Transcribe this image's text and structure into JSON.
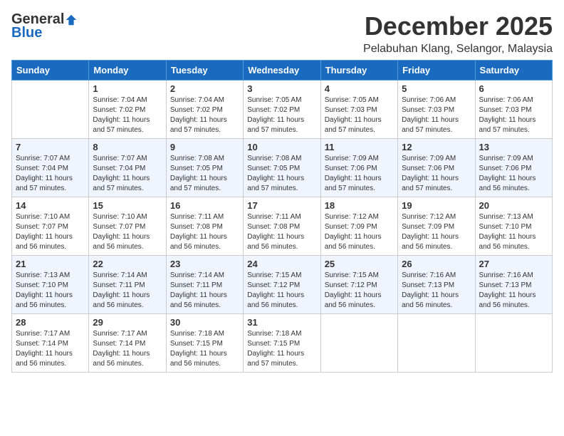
{
  "logo": {
    "general": "General",
    "blue": "Blue"
  },
  "title": "December 2025",
  "subtitle": "Pelabuhan Klang, Selangor, Malaysia",
  "weekdays": [
    "Sunday",
    "Monday",
    "Tuesday",
    "Wednesday",
    "Thursday",
    "Friday",
    "Saturday"
  ],
  "weeks": [
    [
      {
        "day": "",
        "info": ""
      },
      {
        "day": "1",
        "info": "Sunrise: 7:04 AM\nSunset: 7:02 PM\nDaylight: 11 hours\nand 57 minutes."
      },
      {
        "day": "2",
        "info": "Sunrise: 7:04 AM\nSunset: 7:02 PM\nDaylight: 11 hours\nand 57 minutes."
      },
      {
        "day": "3",
        "info": "Sunrise: 7:05 AM\nSunset: 7:02 PM\nDaylight: 11 hours\nand 57 minutes."
      },
      {
        "day": "4",
        "info": "Sunrise: 7:05 AM\nSunset: 7:03 PM\nDaylight: 11 hours\nand 57 minutes."
      },
      {
        "day": "5",
        "info": "Sunrise: 7:06 AM\nSunset: 7:03 PM\nDaylight: 11 hours\nand 57 minutes."
      },
      {
        "day": "6",
        "info": "Sunrise: 7:06 AM\nSunset: 7:03 PM\nDaylight: 11 hours\nand 57 minutes."
      }
    ],
    [
      {
        "day": "7",
        "info": "Sunrise: 7:07 AM\nSunset: 7:04 PM\nDaylight: 11 hours\nand 57 minutes."
      },
      {
        "day": "8",
        "info": "Sunrise: 7:07 AM\nSunset: 7:04 PM\nDaylight: 11 hours\nand 57 minutes."
      },
      {
        "day": "9",
        "info": "Sunrise: 7:08 AM\nSunset: 7:05 PM\nDaylight: 11 hours\nand 57 minutes."
      },
      {
        "day": "10",
        "info": "Sunrise: 7:08 AM\nSunset: 7:05 PM\nDaylight: 11 hours\nand 57 minutes."
      },
      {
        "day": "11",
        "info": "Sunrise: 7:09 AM\nSunset: 7:06 PM\nDaylight: 11 hours\nand 57 minutes."
      },
      {
        "day": "12",
        "info": "Sunrise: 7:09 AM\nSunset: 7:06 PM\nDaylight: 11 hours\nand 57 minutes."
      },
      {
        "day": "13",
        "info": "Sunrise: 7:09 AM\nSunset: 7:06 PM\nDaylight: 11 hours\nand 56 minutes."
      }
    ],
    [
      {
        "day": "14",
        "info": "Sunrise: 7:10 AM\nSunset: 7:07 PM\nDaylight: 11 hours\nand 56 minutes."
      },
      {
        "day": "15",
        "info": "Sunrise: 7:10 AM\nSunset: 7:07 PM\nDaylight: 11 hours\nand 56 minutes."
      },
      {
        "day": "16",
        "info": "Sunrise: 7:11 AM\nSunset: 7:08 PM\nDaylight: 11 hours\nand 56 minutes."
      },
      {
        "day": "17",
        "info": "Sunrise: 7:11 AM\nSunset: 7:08 PM\nDaylight: 11 hours\nand 56 minutes."
      },
      {
        "day": "18",
        "info": "Sunrise: 7:12 AM\nSunset: 7:09 PM\nDaylight: 11 hours\nand 56 minutes."
      },
      {
        "day": "19",
        "info": "Sunrise: 7:12 AM\nSunset: 7:09 PM\nDaylight: 11 hours\nand 56 minutes."
      },
      {
        "day": "20",
        "info": "Sunrise: 7:13 AM\nSunset: 7:10 PM\nDaylight: 11 hours\nand 56 minutes."
      }
    ],
    [
      {
        "day": "21",
        "info": "Sunrise: 7:13 AM\nSunset: 7:10 PM\nDaylight: 11 hours\nand 56 minutes."
      },
      {
        "day": "22",
        "info": "Sunrise: 7:14 AM\nSunset: 7:11 PM\nDaylight: 11 hours\nand 56 minutes."
      },
      {
        "day": "23",
        "info": "Sunrise: 7:14 AM\nSunset: 7:11 PM\nDaylight: 11 hours\nand 56 minutes."
      },
      {
        "day": "24",
        "info": "Sunrise: 7:15 AM\nSunset: 7:12 PM\nDaylight: 11 hours\nand 56 minutes."
      },
      {
        "day": "25",
        "info": "Sunrise: 7:15 AM\nSunset: 7:12 PM\nDaylight: 11 hours\nand 56 minutes."
      },
      {
        "day": "26",
        "info": "Sunrise: 7:16 AM\nSunset: 7:13 PM\nDaylight: 11 hours\nand 56 minutes."
      },
      {
        "day": "27",
        "info": "Sunrise: 7:16 AM\nSunset: 7:13 PM\nDaylight: 11 hours\nand 56 minutes."
      }
    ],
    [
      {
        "day": "28",
        "info": "Sunrise: 7:17 AM\nSunset: 7:14 PM\nDaylight: 11 hours\nand 56 minutes."
      },
      {
        "day": "29",
        "info": "Sunrise: 7:17 AM\nSunset: 7:14 PM\nDaylight: 11 hours\nand 56 minutes."
      },
      {
        "day": "30",
        "info": "Sunrise: 7:18 AM\nSunset: 7:15 PM\nDaylight: 11 hours\nand 56 minutes."
      },
      {
        "day": "31",
        "info": "Sunrise: 7:18 AM\nSunset: 7:15 PM\nDaylight: 11 hours\nand 57 minutes."
      },
      {
        "day": "",
        "info": ""
      },
      {
        "day": "",
        "info": ""
      },
      {
        "day": "",
        "info": ""
      }
    ]
  ]
}
